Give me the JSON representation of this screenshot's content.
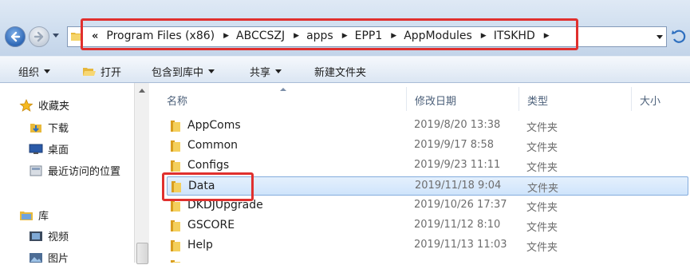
{
  "address_bar": {
    "overflow_chevron": "«",
    "breadcrumbs": [
      "Program Files (x86)",
      "ABCCSZJ",
      "apps",
      "EPP1",
      "AppModules",
      "ITSKHD"
    ]
  },
  "toolbar": {
    "organize": "组织",
    "open": "打开",
    "include_in_library": "包含到库中",
    "share": "共享",
    "new_folder": "新建文件夹"
  },
  "nav_pane": {
    "favorites": "收藏夹",
    "downloads": "下载",
    "desktop": "桌面",
    "recent_places": "最近访问的位置",
    "libraries": "库",
    "videos": "视频",
    "pictures": "图片"
  },
  "columns": {
    "name": "名称",
    "date_modified": "修改日期",
    "type": "类型",
    "size": "大小"
  },
  "files": [
    {
      "name": "AppComs",
      "date": "2019/8/20 13:38",
      "type": "文件夹"
    },
    {
      "name": "Common",
      "date": "2019/9/17 8:58",
      "type": "文件夹"
    },
    {
      "name": "Configs",
      "date": "2019/9/23 11:11",
      "type": "文件夹"
    },
    {
      "name": "Data",
      "date": "2019/11/18 9:04",
      "type": "文件夹",
      "selected": true
    },
    {
      "name": "DKDJUpgrade",
      "date": "2019/10/26 17:37",
      "type": "文件夹"
    },
    {
      "name": "GSCORE",
      "date": "2019/11/12 8:10",
      "type": "文件夹"
    },
    {
      "name": "Help",
      "date": "2019/11/13 11:03",
      "type": "文件夹"
    }
  ],
  "colors": {
    "highlight_box": "#e0302e",
    "selection_fill": "#d9eafc",
    "folder_yellow": "#f2c94c"
  }
}
